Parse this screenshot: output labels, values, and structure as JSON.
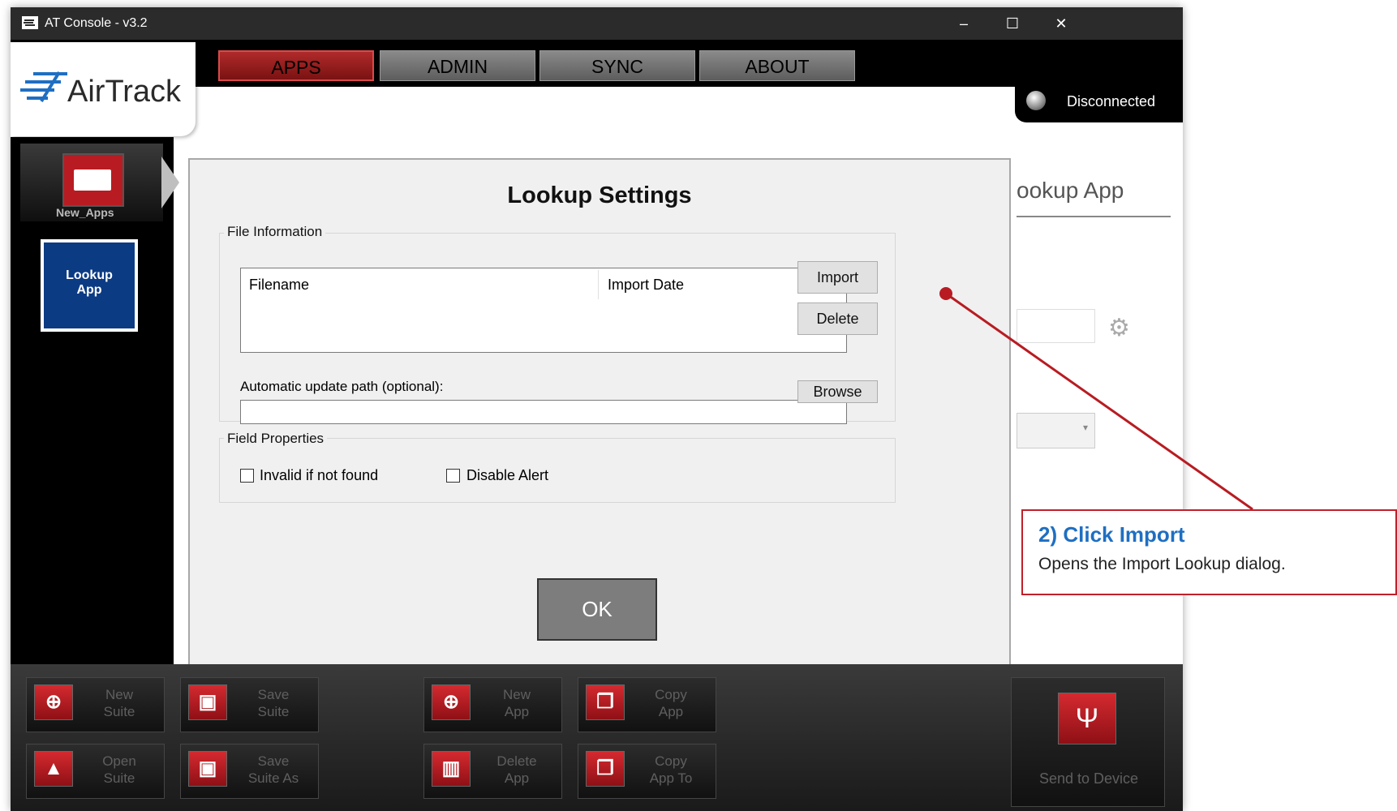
{
  "window": {
    "title": "AT Console - v3.2",
    "controls": [
      "–",
      "☐",
      "✕"
    ]
  },
  "logo": {
    "text": "AirTrack"
  },
  "nav": {
    "tabs": [
      "APPS",
      "ADMIN",
      "SYNC",
      "ABOUT"
    ],
    "active": "APPS"
  },
  "status": {
    "label": "Disconnected"
  },
  "sidebar": {
    "suite_label": "New_Apps",
    "app_line1": "Lookup",
    "app_line2": "App"
  },
  "background": {
    "title_partial": "ookup App",
    "gear_icon": "gear-icon"
  },
  "dialog": {
    "title": "Lookup Settings",
    "file_info_label": "File Information",
    "col_filename": "Filename",
    "col_import_date": "Import Date",
    "import_label": "Import",
    "delete_label": "Delete",
    "path_label": "Automatic update path (optional):",
    "path_value": "",
    "browse_label": "Browse",
    "field_props_label": "Field Properties",
    "invalid_label": "Invalid if not found",
    "disable_alert_label": "Disable Alert",
    "ok_label": "OK"
  },
  "toolbar": {
    "new_suite": [
      "New",
      "Suite"
    ],
    "save_suite": [
      "Save",
      "Suite"
    ],
    "open_suite": [
      "Open",
      "Suite"
    ],
    "save_suite_as": [
      "Save",
      "Suite As"
    ],
    "new_app": [
      "New",
      "App"
    ],
    "copy_app": [
      "Copy",
      "App"
    ],
    "delete_app": [
      "Delete",
      "App"
    ],
    "copy_app_to": [
      "Copy",
      "App To"
    ],
    "send_to_device": "Send to Device"
  },
  "callout": {
    "title": "2) Click Import",
    "desc": "Opens the Import Lookup dialog."
  },
  "colors": {
    "accent_red": "#b81c22",
    "callout_blue": "#1e6fc2",
    "app_blue": "#0b3b83"
  }
}
